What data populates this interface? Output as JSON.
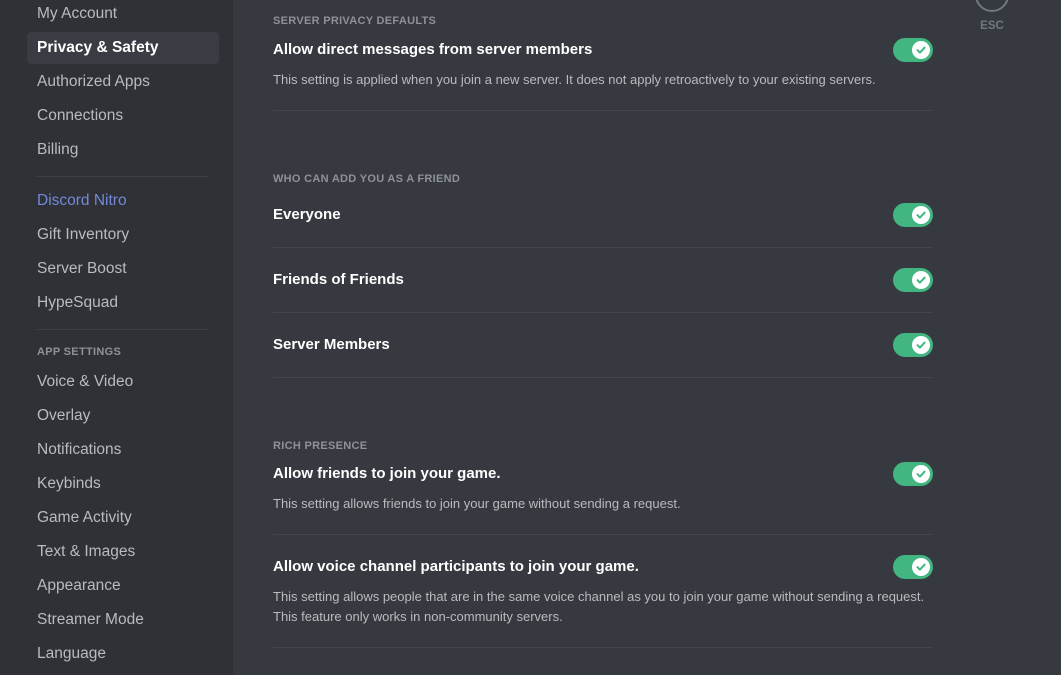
{
  "sidebar": {
    "user_items": [
      {
        "label": "My Account"
      },
      {
        "label": "Privacy & Safety",
        "active": true
      },
      {
        "label": "Authorized Apps"
      },
      {
        "label": "Connections"
      },
      {
        "label": "Billing"
      }
    ],
    "nitro_items": [
      {
        "label": "Discord Nitro"
      },
      {
        "label": "Gift Inventory"
      },
      {
        "label": "Server Boost"
      },
      {
        "label": "HypeSquad"
      }
    ],
    "app_settings_header": "APP SETTINGS",
    "app_items": [
      {
        "label": "Voice & Video"
      },
      {
        "label": "Overlay"
      },
      {
        "label": "Notifications"
      },
      {
        "label": "Keybinds"
      },
      {
        "label": "Game Activity"
      },
      {
        "label": "Text & Images"
      },
      {
        "label": "Appearance"
      },
      {
        "label": "Streamer Mode"
      },
      {
        "label": "Language"
      }
    ]
  },
  "close": {
    "label": "ESC",
    "icon": "close-icon"
  },
  "colors": {
    "accent_green": "#43b581",
    "nitro_blue": "#7289da"
  },
  "sections": {
    "server_privacy": {
      "title": "Server Privacy Defaults",
      "option": {
        "label": "Allow direct messages from server members",
        "description": "This setting is applied when you join a new server. It does not apply retroactively to your existing servers.",
        "enabled": true
      }
    },
    "friend_requests": {
      "title": "Who can add you as a friend",
      "options": [
        {
          "label": "Everyone",
          "enabled": true
        },
        {
          "label": "Friends of Friends",
          "enabled": true
        },
        {
          "label": "Server Members",
          "enabled": true
        }
      ]
    },
    "rich_presence": {
      "title": "Rich Presence",
      "options": [
        {
          "label": "Allow friends to join your game.",
          "description": "This setting allows friends to join your game without sending a request.",
          "enabled": true
        },
        {
          "label": "Allow voice channel participants to join your game.",
          "description": "This setting allows people that are in the same voice channel as you to join your game without sending a request. This feature only works in non-community servers.",
          "enabled": true
        }
      ]
    }
  }
}
